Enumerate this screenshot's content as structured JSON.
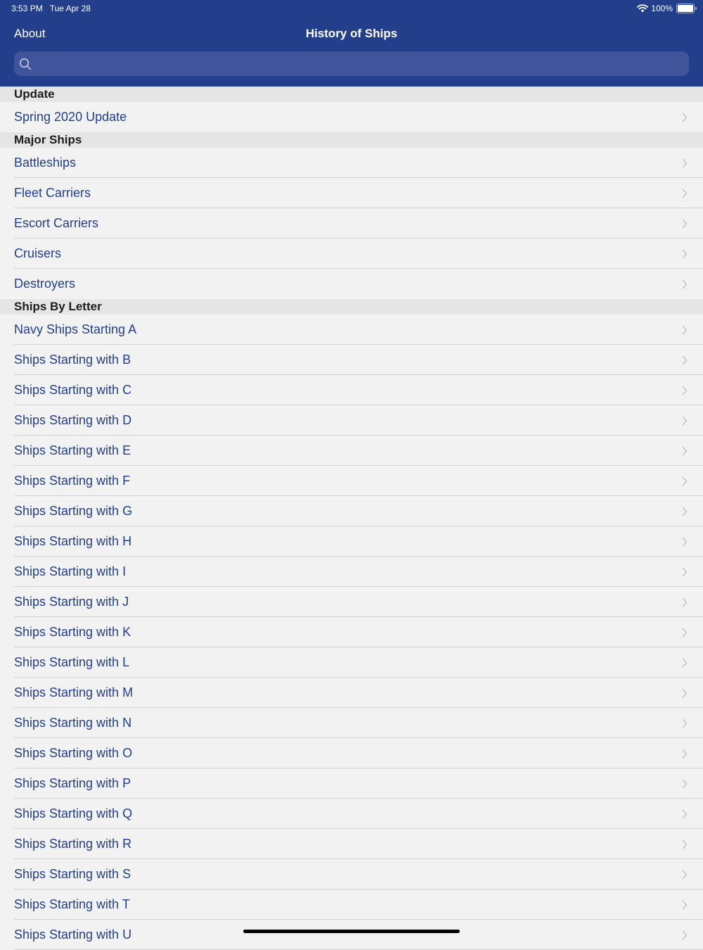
{
  "status_bar": {
    "time": "3:53 PM",
    "date": "Tue Apr 28",
    "battery": "100%",
    "icons": [
      "wifi-icon",
      "battery-icon"
    ]
  },
  "nav": {
    "left_button": "About",
    "title": "History of Ships"
  },
  "search": {
    "placeholder": "",
    "icon": "search-icon"
  },
  "colors": {
    "header_bg": "#233e8b",
    "link_text": "#233e8b",
    "section_bg": "#e5e5e5",
    "list_bg": "#f2f2f2"
  },
  "sections": [
    {
      "header": "Update",
      "items": [
        "Spring 2020 Update"
      ]
    },
    {
      "header": "Major Ships",
      "items": [
        "Battleships",
        "Fleet Carriers",
        "Escort Carriers",
        "Cruisers",
        "Destroyers"
      ]
    },
    {
      "header": "Ships By Letter",
      "items": [
        "Navy Ships Starting A",
        "Ships Starting with B",
        "Ships Starting with C",
        "Ships Starting with D",
        "Ships Starting with E",
        "Ships Starting with F",
        "Ships Starting with G",
        "Ships Starting with H",
        "Ships Starting with I",
        "Ships Starting with J",
        "Ships Starting with K",
        "Ships Starting with L",
        "Ships Starting with M",
        "Ships Starting with N",
        "Ships Starting with O",
        "Ships Starting with P",
        "Ships Starting with Q",
        "Ships Starting with R",
        "Ships Starting with S",
        "Ships Starting with T",
        "Ships Starting with U"
      ]
    }
  ]
}
